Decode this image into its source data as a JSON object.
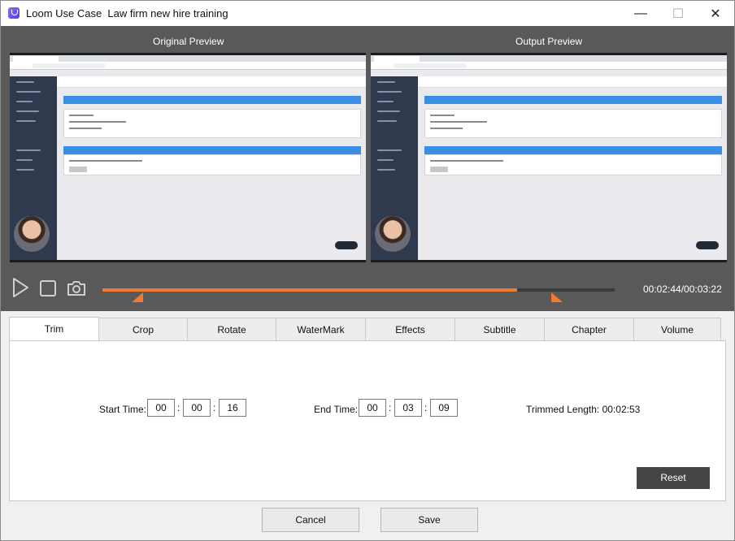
{
  "window": {
    "title": "Loom Use Case  Law firm new hire training",
    "minimize_glyph": "—",
    "maximize_glyph": "☐",
    "close_glyph": "✕"
  },
  "preview": {
    "original_label": "Original Preview",
    "output_label": "Output Preview"
  },
  "playback": {
    "time_readout": "00:02:44/00:03:22",
    "progress_fraction": 0.809,
    "trim_start_fraction": 0.079,
    "trim_end_fraction": 0.876,
    "accent_color": "#f07a2d"
  },
  "tabs": [
    {
      "label": "Trim",
      "active": true
    },
    {
      "label": "Crop",
      "active": false
    },
    {
      "label": "Rotate",
      "active": false
    },
    {
      "label": "WaterMark",
      "active": false
    },
    {
      "label": "Effects",
      "active": false
    },
    {
      "label": "Subtitle",
      "active": false
    },
    {
      "label": "Chapter",
      "active": false
    },
    {
      "label": "Volume",
      "active": false
    }
  ],
  "trim": {
    "start_label": "Start Time:",
    "start": {
      "h": "00",
      "m": "00",
      "s": "16"
    },
    "end_label": "End Time:",
    "end": {
      "h": "00",
      "m": "03",
      "s": "09"
    },
    "colon": ":",
    "trimmed_length": "Trimmed Length: 00:02:53",
    "reset_label": "Reset"
  },
  "footer": {
    "cancel_label": "Cancel",
    "save_label": "Save"
  },
  "icons": {
    "play": "play-icon",
    "stop": "stop-icon",
    "snapshot": "camera-icon"
  }
}
